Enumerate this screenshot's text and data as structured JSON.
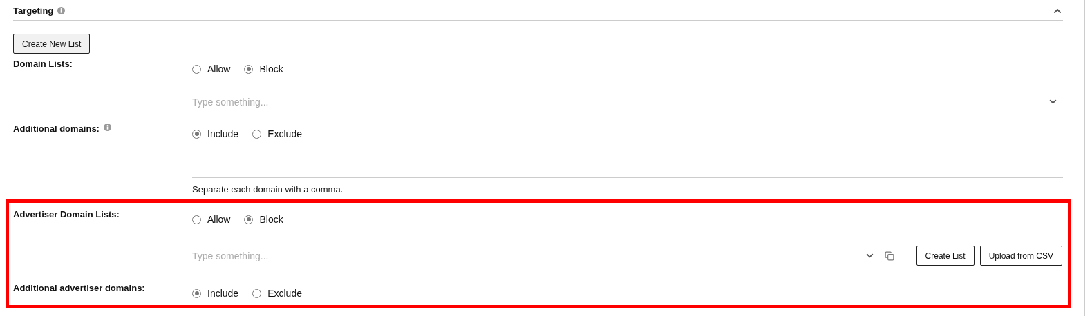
{
  "section": {
    "title": "Targeting",
    "info": true,
    "expanded": true
  },
  "create_button": "Create New List",
  "rows": [
    {
      "kind": "radio",
      "label": "Domain Lists:",
      "info": false,
      "options": [
        {
          "label": "Allow",
          "selected": false
        },
        {
          "label": "Block",
          "selected": true
        }
      ]
    },
    {
      "kind": "select",
      "placeholder": "Type something..."
    },
    {
      "kind": "radio",
      "label": "Additional domains:",
      "info": true,
      "options": [
        {
          "label": "Include",
          "selected": true
        },
        {
          "label": "Exclude",
          "selected": false
        }
      ]
    },
    {
      "kind": "textarea",
      "hint": "Separate each domain with a comma."
    }
  ],
  "highlight": {
    "rows": [
      {
        "kind": "radio",
        "label": "Advertiser Domain Lists:",
        "info": false,
        "options": [
          {
            "label": "Allow",
            "selected": false
          },
          {
            "label": "Block",
            "selected": true
          }
        ]
      },
      {
        "kind": "select",
        "placeholder": "Type something...",
        "copy": true,
        "buttons": [
          "Create List",
          "Upload from CSV"
        ]
      },
      {
        "kind": "radio",
        "label": "Additional advertiser domains:",
        "info": false,
        "options": [
          {
            "label": "Include",
            "selected": true
          },
          {
            "label": "Exclude",
            "selected": false
          }
        ]
      }
    ]
  }
}
